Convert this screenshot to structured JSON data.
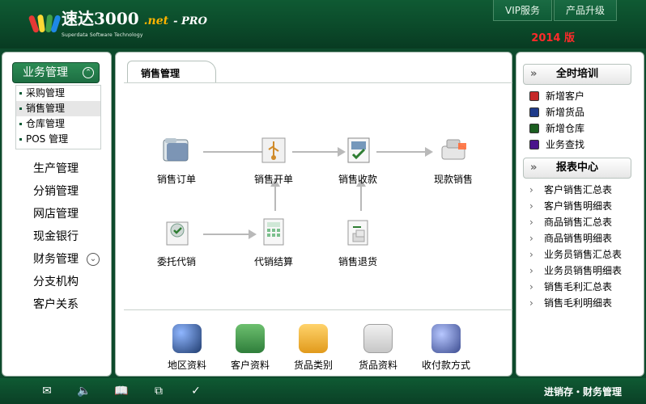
{
  "header": {
    "logo_text": "速达3000",
    "logo_net": ".net",
    "logo_pro": "- PRO",
    "logo_sub": "Superdata Software Technology",
    "top_actions": [
      "VIP服务",
      "产品升级"
    ],
    "version": "2014 版"
  },
  "left_nav": {
    "section_title": "业务管理",
    "sub_items": [
      {
        "label": "采购管理",
        "active": false
      },
      {
        "label": "销售管理",
        "active": true
      },
      {
        "label": "仓库管理",
        "active": false
      },
      {
        "label": "POS 管理",
        "active": false
      }
    ],
    "items": [
      {
        "label": "生产管理"
      },
      {
        "label": "分销管理"
      },
      {
        "label": "网店管理"
      },
      {
        "label": "现金银行"
      },
      {
        "label": "财务管理",
        "has_chevron": true
      },
      {
        "label": "分支机构"
      },
      {
        "label": "客户关系"
      }
    ]
  },
  "main": {
    "tab_title": "销售管理",
    "flow": [
      {
        "id": "sales-order",
        "label": "销售订单",
        "icon": "folder-icon"
      },
      {
        "id": "sales-invoice",
        "label": "销售开单",
        "icon": "usb-box-icon"
      },
      {
        "id": "sales-receipt",
        "label": "销售收款",
        "icon": "check-document-icon"
      },
      {
        "id": "cash-sale",
        "label": "现款销售",
        "icon": "cash-register-icon"
      },
      {
        "id": "consign",
        "label": "委托代销",
        "icon": "check-circle-doc-icon"
      },
      {
        "id": "consign-settle",
        "label": "代销结算",
        "icon": "calculator-doc-icon"
      },
      {
        "id": "sales-return",
        "label": "销售退货",
        "icon": "return-doc-icon"
      }
    ],
    "bottom_tools": [
      {
        "id": "region",
        "label": "地区资料",
        "icon": "globe-icon"
      },
      {
        "id": "customer",
        "label": "客户资料",
        "icon": "customer-icon"
      },
      {
        "id": "goods-cat",
        "label": "货品类别",
        "icon": "boxes-icon"
      },
      {
        "id": "goods",
        "label": "货品资料",
        "icon": "goods-icon"
      },
      {
        "id": "payment",
        "label": "收付款方式",
        "icon": "payment-icon"
      }
    ]
  },
  "right": {
    "training_title": "全时培训",
    "training_items": [
      {
        "label": "新增客户",
        "icon": "red-book-icon"
      },
      {
        "label": "新增货品",
        "icon": "blue-book-icon"
      },
      {
        "label": "新增仓库",
        "icon": "green-book-icon"
      },
      {
        "label": "业务查找",
        "icon": "purple-book-icon"
      }
    ],
    "report_title": "报表中心",
    "report_items": [
      {
        "label": "客户销售汇总表"
      },
      {
        "label": "客户销售明细表"
      },
      {
        "label": "商品销售汇总表"
      },
      {
        "label": "商品销售明细表"
      },
      {
        "label": "业务员销售汇总表"
      },
      {
        "label": "业务员销售明细表"
      },
      {
        "label": "销售毛利汇总表"
      },
      {
        "label": "销售毛利明细表"
      }
    ]
  },
  "footer": {
    "icons": [
      "mail-icon",
      "speaker-icon",
      "book-icon",
      "copy-icon",
      "check-icon"
    ],
    "text": "进销存・财务管理"
  },
  "colors": {
    "brand_green": "#0f5a33",
    "version_red": "#ff2a2a",
    "logo_orange": "#ffb400"
  }
}
